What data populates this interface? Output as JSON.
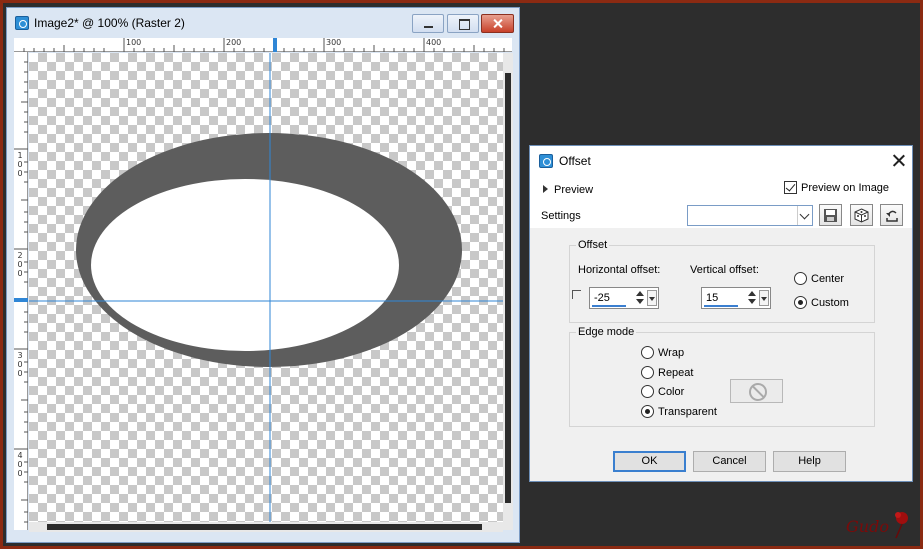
{
  "image_window": {
    "title": "Image2* @ 100% (Raster 2)",
    "ruler_top_labels": [
      "100",
      "200",
      "300",
      "400"
    ],
    "ruler_left_labels": [
      "1 0 0",
      "2 0 0",
      "3 0 0",
      "4 0 0"
    ],
    "icons": [
      "app-icon",
      "minimize-icon",
      "maximize-icon",
      "close-icon"
    ]
  },
  "dialog": {
    "title": "Offset",
    "preview_label": "Preview",
    "preview_on_image_label": "Preview on Image",
    "preview_on_image_checked": true,
    "settings_label": "Settings",
    "settings_value": "",
    "toolbar_icons": [
      "save-icon",
      "randomize-icon",
      "reset-icon"
    ],
    "offset_group": {
      "legend": "Offset",
      "horizontal_label": "Horizontal offset:",
      "horizontal_value": "-25",
      "vertical_label": "Vertical offset:",
      "vertical_value": "15",
      "center_label": "Center",
      "custom_label": "Custom",
      "selected": "Custom"
    },
    "edge_group": {
      "legend": "Edge mode",
      "options": [
        "Wrap",
        "Repeat",
        "Color",
        "Transparent"
      ],
      "selected": "Transparent"
    },
    "buttons": {
      "ok": "OK",
      "cancel": "Cancel",
      "help": "Help"
    }
  },
  "watermark": "Gudo",
  "colors": {
    "accent": "#3a7fcf",
    "ellipse_ring": "#5d5d5d",
    "guide_line": "#2f86d6",
    "frame_border": "#8b2a12",
    "workspace": "#2d2d2d"
  }
}
